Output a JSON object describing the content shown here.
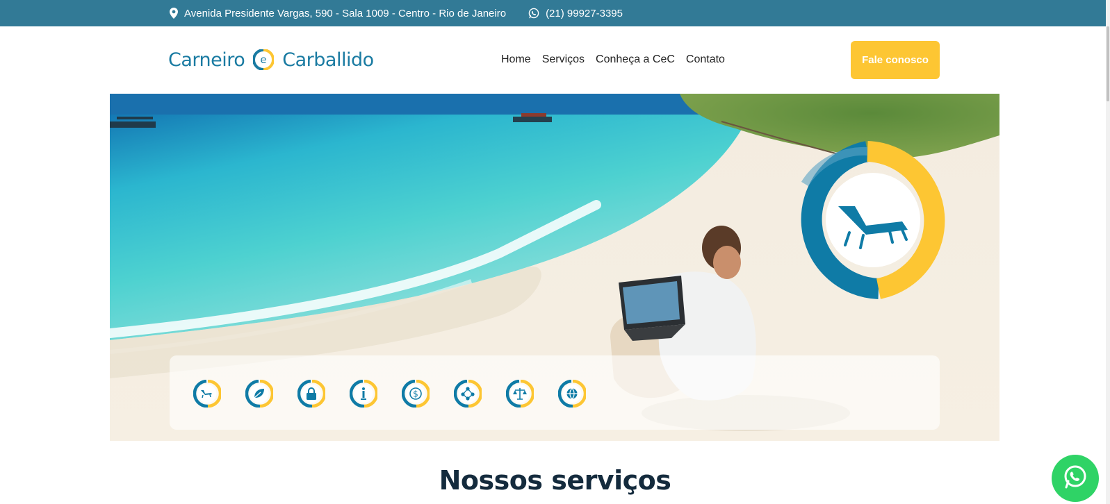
{
  "topbar": {
    "address": "Avenida Presidente Vargas, 590 - Sala 1009 - Centro - Rio de Janeiro",
    "phone": "(21) 99927-3395",
    "background": "#327a96"
  },
  "header": {
    "logo": {
      "left_word": "Carneiro",
      "middle": "e",
      "right_word": "Carballido"
    },
    "nav": [
      "Home",
      "Serviços",
      "Conheça a CeC",
      "Contato"
    ],
    "cta_label": "Fale conosco",
    "cta_color": "#fdc633"
  },
  "hero": {
    "badge_icon": "beach-chair-icon",
    "service_icons": [
      "beach-chair-icon",
      "leaf-icon",
      "lock-icon",
      "info-icon",
      "dollar-icon",
      "network-icon",
      "scales-icon",
      "globe-icon"
    ]
  },
  "section": {
    "title": "Nossos serviços"
  },
  "colors": {
    "blue": "#0f7ba6",
    "yellow": "#fdc633",
    "dark": "#142b3d",
    "whatsapp": "#2fd366"
  }
}
